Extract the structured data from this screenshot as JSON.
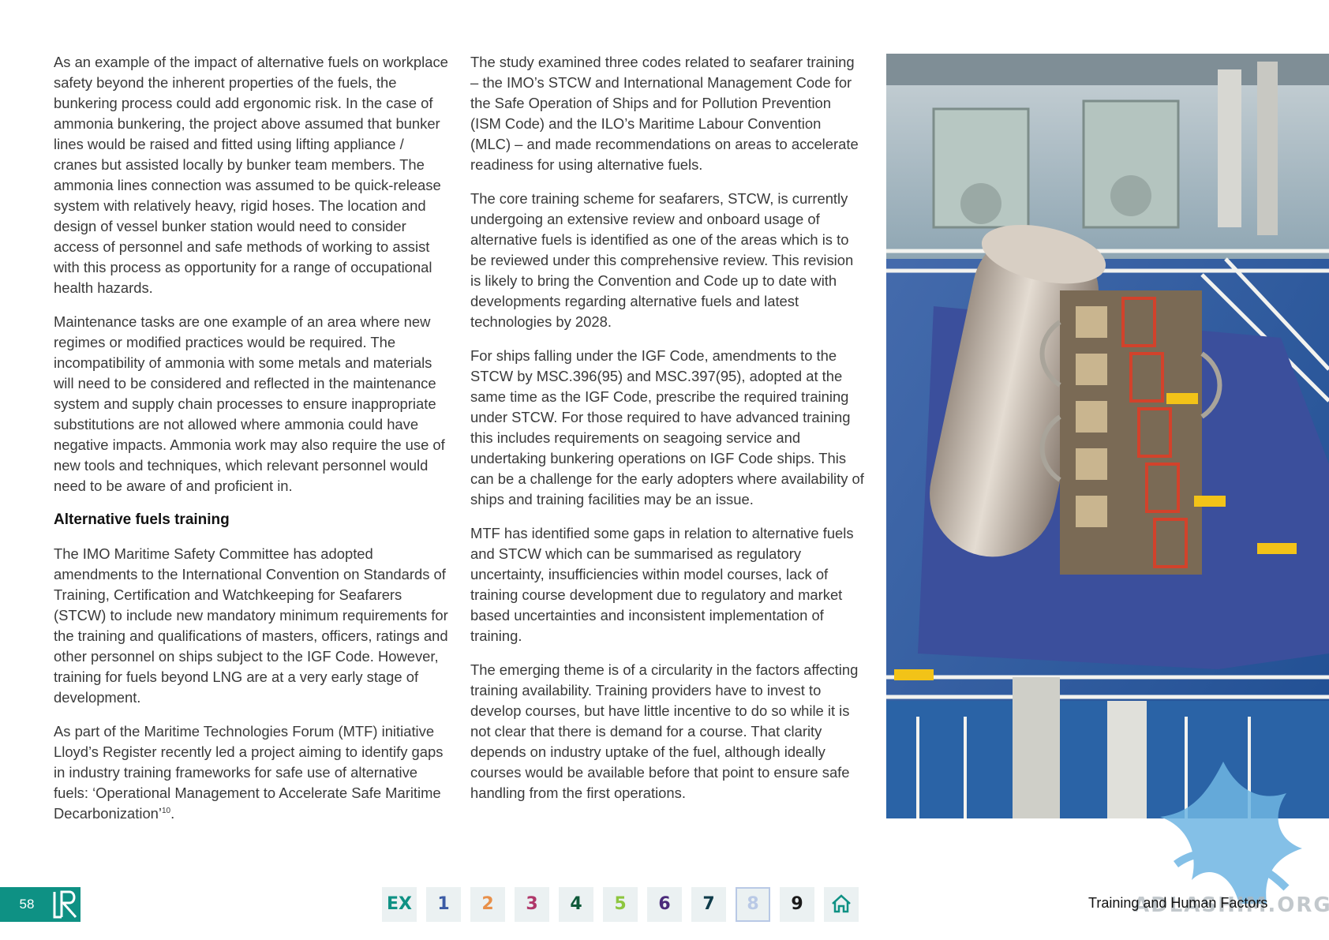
{
  "column1": {
    "para1": "As an example of the impact of alternative fuels on workplace safety beyond the inherent properties of the fuels, the bunkering process could add ergonomic risk. In the case of ammonia bunkering, the project above assumed that bunker lines would be raised and fitted using lifting appliance / cranes but assisted locally by bunker team members. The ammonia lines connection was assumed to be quick-release system with relatively heavy, rigid hoses. The location and design of vessel bunker station would need to consider access of personnel and safe methods of working to assist with this process as opportunity for a range of occupational health hazards.",
    "para2": "Maintenance tasks are one example of an area where new regimes or modified practices would be required. The incompatibility of ammonia with some metals and materials will need to be considered and reflected in the maintenance system and supply chain processes to ensure inappropriate substitutions are not allowed where ammonia could have negative impacts. Ammonia work may also require the use of new tools and techniques, which relevant personnel would need to be aware of and proficient in.",
    "heading": "Alternative fuels training",
    "para3": "The IMO Maritime Safety Committee has adopted amendments to the International Convention on Standards of Training, Certification and Watchkeeping for Seafarers (STCW) to include new mandatory minimum requirements for the training and qualifications of masters, officers, ratings and other personnel on ships subject to the IGF Code. However, training for fuels beyond LNG are at a very early stage of development.",
    "para4": "As part of the Maritime Technologies Forum (MTF) initiative Lloyd’s Register recently led a project aiming to identify gaps in industry training frameworks for safe use of alternative fuels: ‘Operational Management to Accelerate Safe Maritime Decarbonization’",
    "para4_footnote": "10",
    "para4_end": "."
  },
  "column2": {
    "para1": "The study examined three codes related to seafarer training – the IMO’s STCW and International Management Code for the Safe Operation of Ships and for Pollution Prevention (ISM Code) and the ILO’s Maritime Labour Convention (MLC) – and made recommendations on areas to accelerate readiness for using alternative fuels.",
    "para2": "The core training scheme for seafarers, STCW, is currently undergoing an extensive review and onboard usage of alternative fuels is identified as one of the areas which is to be reviewed under this comprehensive review. This revision is likely to bring the Convention and Code up to date with developments regarding alternative fuels and latest technologies by 2028.",
    "para3": "For ships falling under the IGF Code, amendments to the STCW by MSC.396(95) and MSC.397(95), adopted at the same time as the IGF Code, prescribe the required training under STCW. For those required to have advanced training this includes requirements on seagoing service and undertaking bunkering operations on IGF Code ships. This can be a challenge for the early adopters where availability of ships and training facilities may be an issue.",
    "para4": "MTF has identified some gaps in relation to alternative fuels and STCW which can be summarised as regulatory uncertainty, insufficiencies within model courses, lack of training course development due to regulatory and market based uncertainties and inconsistent implementation of training.",
    "para5": "The emerging theme is of a circularity in the factors affecting training availability. Training providers have to invest to develop courses, but have little incentive to do so while it is not clear that there is demand for a course. That clarity depends on industry uptake of the fuel, although ideally courses would be available before that point to ensure safe handling from the first operations."
  },
  "footer": {
    "page_number": "58",
    "section_title": "Training and Human Factors",
    "nav": [
      {
        "label": "EX",
        "color": "#0e9184"
      },
      {
        "label": "1",
        "color": "#3b5ba5"
      },
      {
        "label": "2",
        "color": "#e8904a"
      },
      {
        "label": "3",
        "color": "#b0386a"
      },
      {
        "label": "4",
        "color": "#0f5a3a"
      },
      {
        "label": "5",
        "color": "#8dc63f"
      },
      {
        "label": "6",
        "color": "#4a2a7a"
      },
      {
        "label": "7",
        "color": "#0f3b4a"
      },
      {
        "label": "8",
        "color": "#b9c9e6"
      },
      {
        "label": "9",
        "color": "#1a1a1a"
      }
    ],
    "watermark": "ADLASHIM.ORG"
  },
  "colors": {
    "accent": "#0e9184",
    "nav_bg": "#ebf1f2"
  }
}
